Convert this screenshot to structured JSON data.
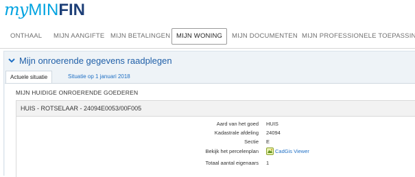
{
  "logo": {
    "my": "my",
    "min": "MIN",
    "fin": "FIN"
  },
  "nav": {
    "items": [
      {
        "label": "ONTHAAL"
      },
      {
        "label": "MIJN AANGIFTE"
      },
      {
        "label": "MIJN BETALINGEN"
      },
      {
        "label": "MIJN WONING"
      },
      {
        "label": "MIJN DOCUMENTEN"
      },
      {
        "label": "MIJN PROFESSIONELE TOEPASSINGEN"
      }
    ],
    "active": "MIJN WONING"
  },
  "section": {
    "title": "Mijn onroerende gegevens raadplegen",
    "tabs": [
      {
        "label": "Actuele situatie"
      },
      {
        "label": "Situatie op 1 januari 2018"
      }
    ],
    "content_title": "MIJN HUIDIGE ONROERENDE GOEDEREN",
    "property": {
      "header": "HUIS - ROTSELAAR - 24094E0053/00F005",
      "fields": [
        {
          "label": "Aard van het goed",
          "value": "HUIS"
        },
        {
          "label": "Kadastrale afdeling",
          "value": "24094"
        },
        {
          "label": "Sectie",
          "value": "E"
        },
        {
          "label": "Bekijk het percelenplan",
          "value": "CadGis Viewer",
          "icon": "cadgis-viewer-icon"
        },
        {
          "label": "Totaal aantal eigenaars",
          "value": "1"
        }
      ]
    }
  },
  "colors": {
    "brand_blue": "#00a3e0",
    "brand_dark": "#1d3f77",
    "link": "#1f6fc4",
    "section_bg": "#eef3f7"
  }
}
